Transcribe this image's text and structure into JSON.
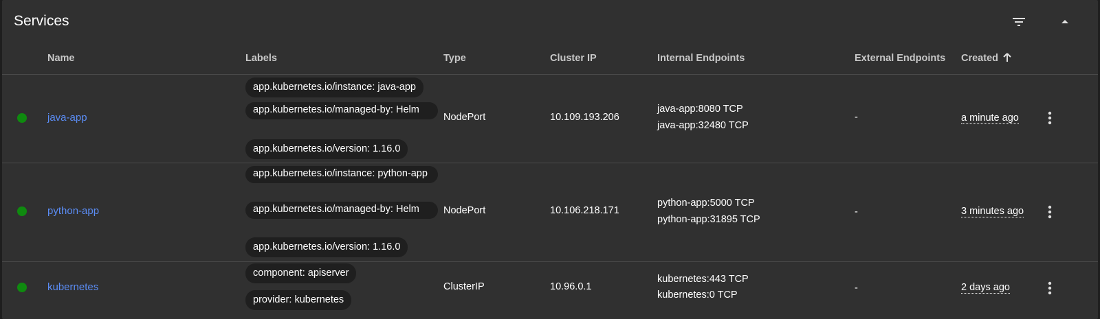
{
  "card": {
    "title": "Services"
  },
  "columns": {
    "name": "Name",
    "labels": "Labels",
    "type": "Type",
    "cluster_ip": "Cluster IP",
    "internal_endpoints": "Internal Endpoints",
    "external_endpoints": "External Endpoints",
    "created": "Created"
  },
  "icons": {
    "filter": "filter-icon",
    "collapse": "chevron-up-icon",
    "sort": "arrow-up-icon",
    "row_menu": "more-vert-icon"
  },
  "colors": {
    "status_ok": "#0f8a0f",
    "link": "#5b8df6",
    "chip_bg": "#1f1f1f",
    "card_bg": "#303030"
  },
  "rows": [
    {
      "status": "running",
      "name": "java-app",
      "labels": [
        "app.kubernetes.io/instance: java-app",
        "app.kubernetes.io/managed-by: Helm",
        "app.kubernetes.io/version: 1.16.0"
      ],
      "type": "NodePort",
      "cluster_ip": "10.109.193.206",
      "internal_endpoints": [
        "java-app:8080 TCP",
        "java-app:32480 TCP"
      ],
      "external_endpoints": "-",
      "created": "a minute ago"
    },
    {
      "status": "running",
      "name": "python-app",
      "labels": [
        "app.kubernetes.io/instance: python-app",
        "app.kubernetes.io/managed-by: Helm",
        "app.kubernetes.io/version: 1.16.0"
      ],
      "type": "NodePort",
      "cluster_ip": "10.106.218.171",
      "internal_endpoints": [
        "python-app:5000 TCP",
        "python-app:31895 TCP"
      ],
      "external_endpoints": "-",
      "created": "3 minutes ago"
    },
    {
      "status": "running",
      "name": "kubernetes",
      "labels": [
        "component: apiserver",
        "provider: kubernetes"
      ],
      "type": "ClusterIP",
      "cluster_ip": "10.96.0.1",
      "internal_endpoints": [
        "kubernetes:443 TCP",
        "kubernetes:0 TCP"
      ],
      "external_endpoints": "-",
      "created": "2 days ago"
    }
  ]
}
